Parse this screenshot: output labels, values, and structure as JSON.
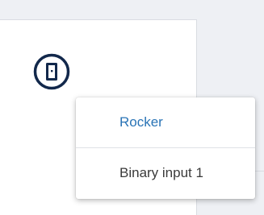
{
  "menu": {
    "items": [
      {
        "label": "Rocker",
        "state": "selected"
      },
      {
        "label": "Binary input 1",
        "state": "normal"
      }
    ]
  },
  "device": {
    "icon": "door-contact-icon",
    "color": "#12284b"
  },
  "colors": {
    "accent": "#2a74b6",
    "background": "#eef0f4",
    "panel": "#ffffff"
  }
}
